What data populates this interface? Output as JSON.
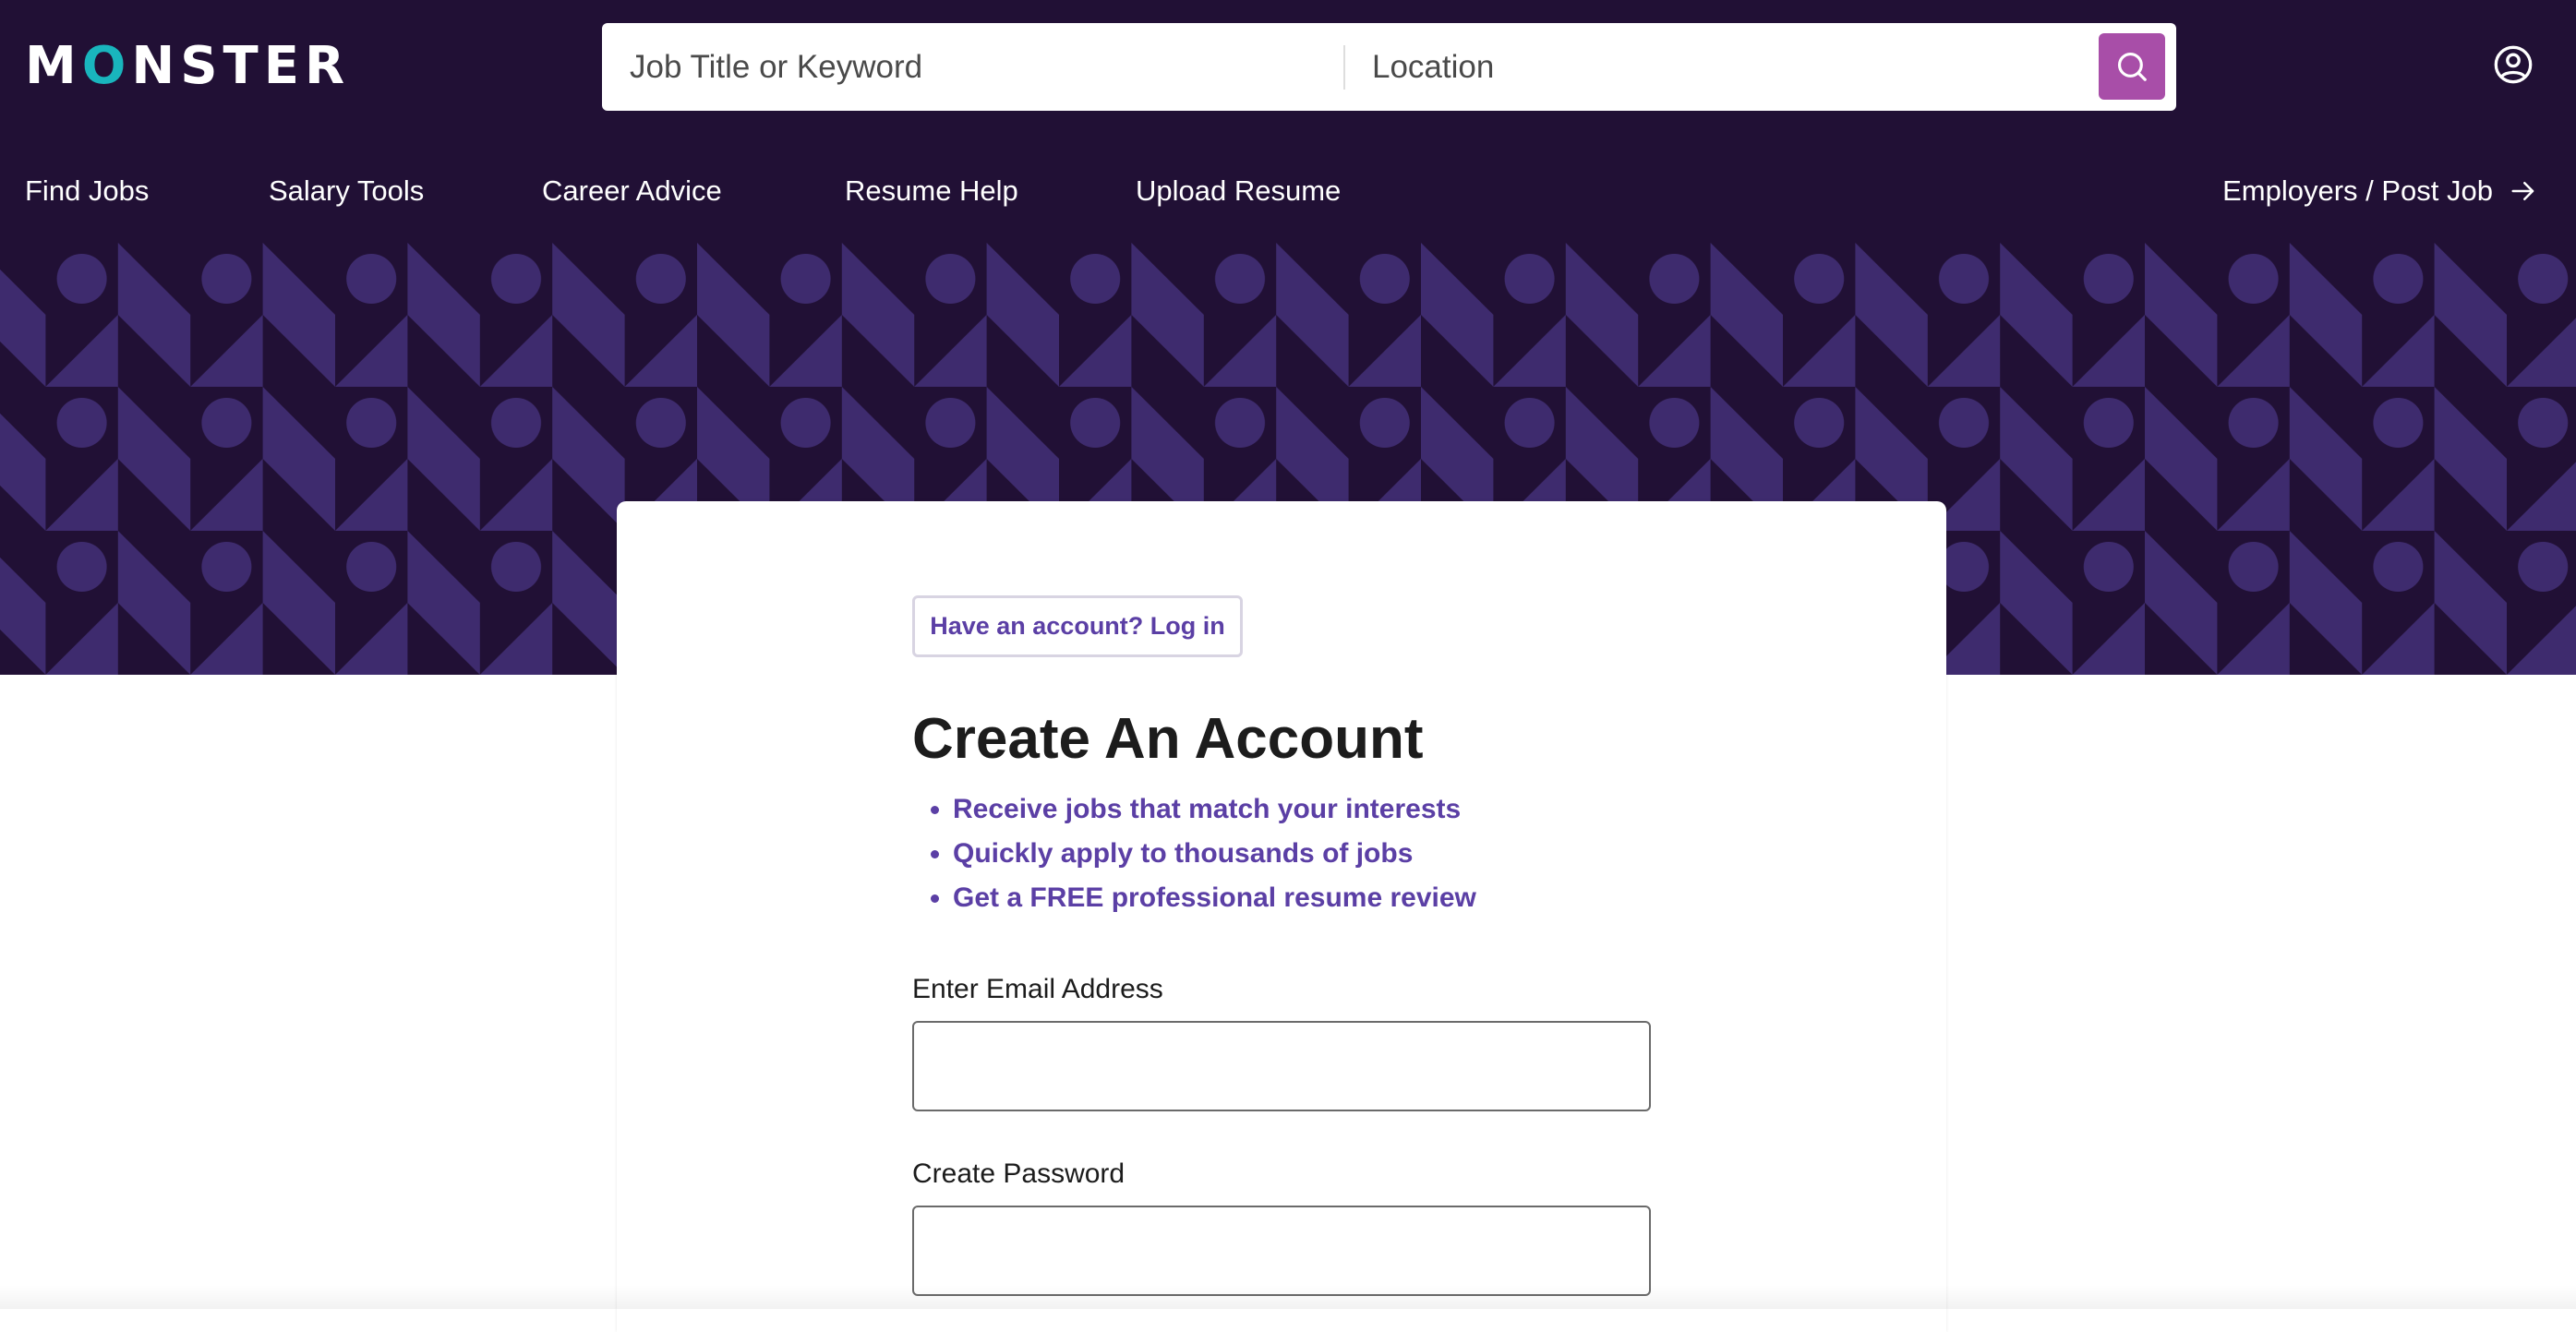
{
  "brand": {
    "logo_text_start": "M",
    "logo_text_o": "O",
    "logo_text_end": "NSTER",
    "primary_color": "#211035",
    "accent_color": "#19b5bd",
    "button_color": "#a84ea8",
    "link_color": "#5b3fa5"
  },
  "search": {
    "keyword_placeholder": "Job Title or Keyword",
    "location_placeholder": "Location",
    "button_icon": "search-icon"
  },
  "account_icon": "user-circle-icon",
  "nav": {
    "items": [
      {
        "label": "Find Jobs"
      },
      {
        "label": "Salary Tools"
      },
      {
        "label": "Career Advice"
      },
      {
        "label": "Resume Help"
      },
      {
        "label": "Upload Resume"
      }
    ],
    "employers_label": "Employers / Post Job",
    "employers_icon": "arrow-right-icon"
  },
  "form": {
    "login_button": "Have an account? Log in",
    "title": "Create An Account",
    "benefits": [
      "Receive jobs that match your interests",
      "Quickly apply to thousands of jobs",
      "Get a FREE professional resume review"
    ],
    "email_label": "Enter Email Address",
    "email_value": "",
    "password_label": "Create Password",
    "password_value": ""
  }
}
